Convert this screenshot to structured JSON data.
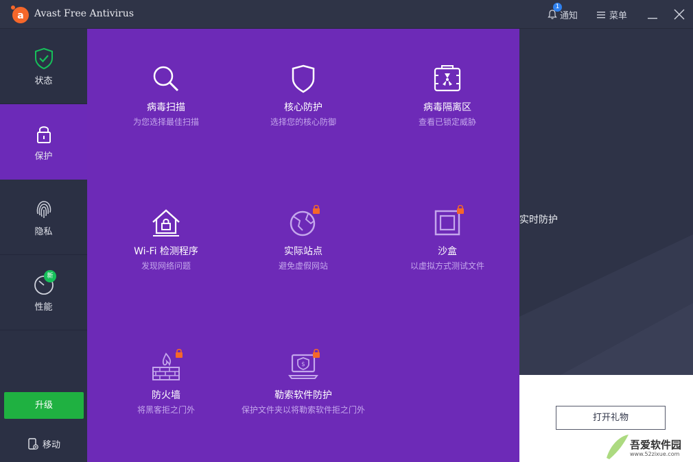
{
  "titlebar": {
    "app_title": "Avast Free Antivirus",
    "notification_label": "通知",
    "notification_count": "1",
    "menu_label": "菜单"
  },
  "sidebar": {
    "items": [
      {
        "label": "状态",
        "icon": "shield-check-icon"
      },
      {
        "label": "保护",
        "icon": "lock-icon"
      },
      {
        "label": "隐私",
        "icon": "fingerprint-icon"
      },
      {
        "label": "性能",
        "icon": "speedometer-icon",
        "badge": "新"
      }
    ],
    "upgrade_label": "升级",
    "mobile_label": "移动"
  },
  "background": {
    "realtime_label": "实时防护",
    "gift_button": "打开礼物"
  },
  "protection_panel": {
    "tiles": [
      {
        "name": "病毒扫描",
        "desc": "为您选择最佳扫描",
        "icon": "search-icon",
        "locked": false
      },
      {
        "name": "核心防护",
        "desc": "选择您的核心防御",
        "icon": "shield-icon",
        "locked": false
      },
      {
        "name": "病毒隔离区",
        "desc": "查看已锁定威胁",
        "icon": "quarantine-icon",
        "locked": false
      },
      {
        "name": "Wi-Fi 检测程序",
        "desc": "发现网络问题",
        "icon": "house-lock-icon",
        "locked": false
      },
      {
        "name": "实际站点",
        "desc": "避免虚假网站",
        "icon": "globe-icon",
        "locked": true
      },
      {
        "name": "沙盒",
        "desc": "以虚拟方式测试文件",
        "icon": "sandbox-icon",
        "locked": true
      },
      {
        "name": "防火墙",
        "desc": "将黑客拒之门外",
        "icon": "firewall-icon",
        "locked": true
      },
      {
        "name": "勒索软件防护",
        "desc": "保护文件夹以将勒索软件拒之门外",
        "icon": "ransomware-shield-icon",
        "locked": true
      }
    ]
  },
  "watermark": {
    "text": "吾爱软件园",
    "url": "www.52zixue.com"
  },
  "colors": {
    "purple_panel": "#6d2ab7",
    "sidebar_bg": "#2b3044",
    "upgrade_green": "#1fb141",
    "lock_orange": "#f5672a",
    "accent_green": "#16c05a"
  }
}
